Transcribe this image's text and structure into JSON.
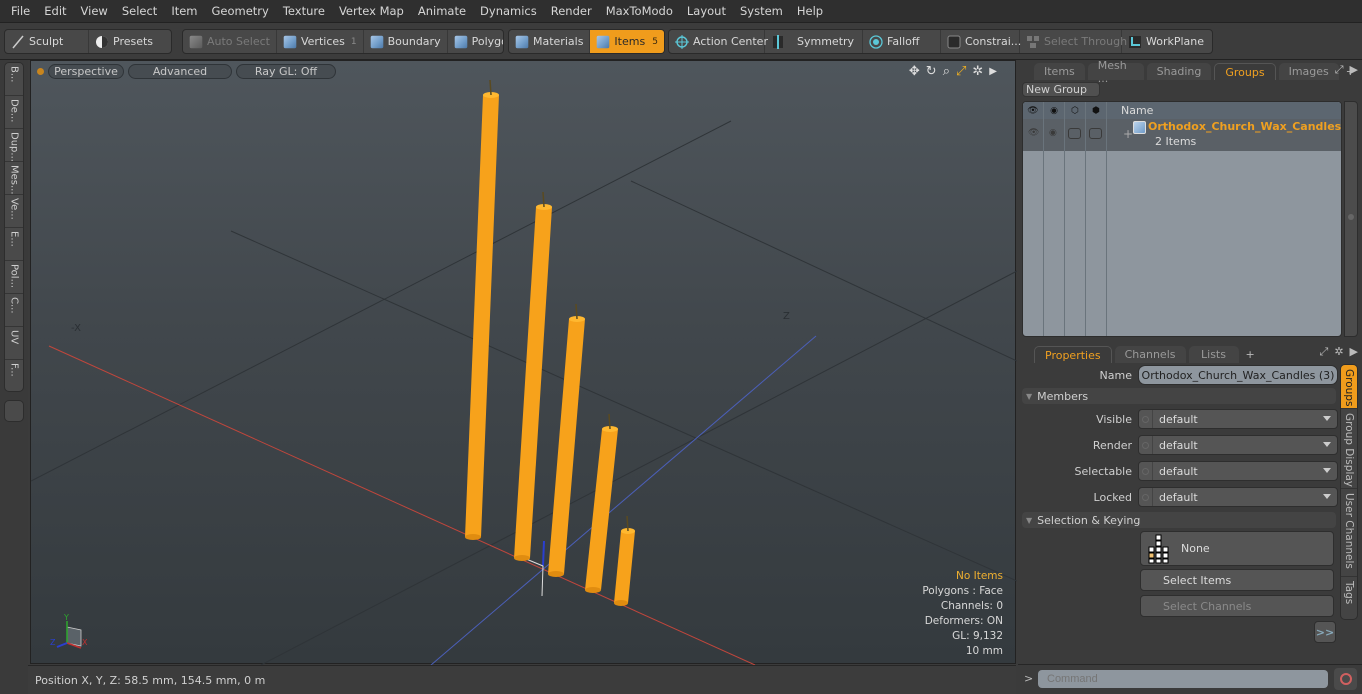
{
  "menu": [
    "File",
    "Edit",
    "View",
    "Select",
    "Item",
    "Geometry",
    "Texture",
    "Vertex Map",
    "Animate",
    "Dynamics",
    "Render",
    "MaxToModo",
    "Layout",
    "System",
    "Help"
  ],
  "toolbar": {
    "sculpt": "Sculpt",
    "presets": "Presets",
    "auto_select": "Auto Select",
    "vertices": "Vertices",
    "vertices_count": "1",
    "boundary": "Boundary",
    "polygons": "Polygons",
    "materials": "Materials",
    "items": "Items",
    "items_count": "5",
    "action_center": "Action Center",
    "symmetry": "Symmetry",
    "falloff": "Falloff",
    "constraints": "Constrai...",
    "select_through": "Select Through",
    "workplane": "WorkPlane"
  },
  "left_tabs": [
    "B...",
    "De...",
    "Dup...",
    "Mes...",
    "Ve...",
    "E...",
    "Pol...",
    "C...",
    "UV",
    "F..."
  ],
  "viewport": {
    "view_mode": "Perspective",
    "shading": "Advanced",
    "raygl": "Ray GL: Off",
    "info": {
      "selection": "No Items",
      "polygons": "Polygons : Face",
      "channels": "Channels: 0",
      "deformers": "Deformers: ON",
      "gl": "GL: 9,132",
      "scale": "10 mm"
    },
    "axis_labels": {
      "x": "X",
      "y": "Y",
      "z": "Z"
    },
    "object_color": "#f7a21b"
  },
  "status": {
    "position": "Position X, Y, Z:   58.5 mm, 154.5 mm, 0 m"
  },
  "top_panel": {
    "tabs": [
      "Items",
      "Mesh ...",
      "Shading",
      "Groups",
      "Images"
    ],
    "active_tab": "Groups",
    "new_group": "New Group",
    "name_header": "Name",
    "group": {
      "name": "Orthodox_Church_Wax_Candles...",
      "count": "2 Items"
    }
  },
  "bottom_panel": {
    "tabs": [
      "Properties",
      "Channels",
      "Lists"
    ],
    "active_tab": "Properties",
    "name_label": "Name",
    "name_value": "Orthodox_Church_Wax_Candles (3)",
    "members_section": "Members",
    "fields": [
      {
        "label": "Visible",
        "value": "default"
      },
      {
        "label": "Render",
        "value": "default"
      },
      {
        "label": "Selectable",
        "value": "default"
      },
      {
        "label": "Locked",
        "value": "default"
      }
    ],
    "selection_section": "Selection & Keying",
    "none_label": "None",
    "select_items": "Select Items",
    "select_channels": "Select Channels",
    "more": ">>"
  },
  "side_tabs": [
    "Groups",
    "Group Display",
    "User Channels",
    "Tags"
  ],
  "command": {
    "prompt": ">",
    "placeholder": "Command"
  },
  "colors": {
    "accent": "#f09c1c",
    "group_name": "#f0a020"
  }
}
